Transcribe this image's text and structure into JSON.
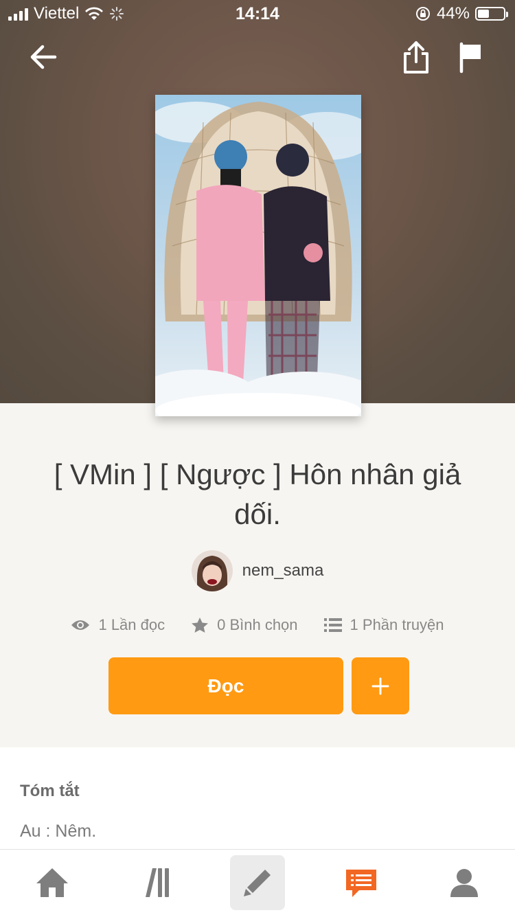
{
  "status_bar": {
    "carrier": "Viettel",
    "time": "14:14",
    "battery_percent": "44%",
    "battery_level": 0.44
  },
  "header": {
    "back_icon": "arrow-left-icon",
    "share_icon": "share-icon",
    "report_icon": "flag-icon"
  },
  "story": {
    "title": "[ VMin ] [ Ngược ] Hôn nhân giả dối.",
    "author": "nem_sama",
    "stats": {
      "reads": "1 Lần đọc",
      "votes": "0 Bình chọn",
      "parts": "1 Phần truyện"
    }
  },
  "actions": {
    "read_label": "Đọc",
    "add_label": "+"
  },
  "summary": {
    "heading": "Tóm tắt",
    "text": "Au : Nêm."
  },
  "tabbar": {
    "items": [
      "home-icon",
      "library-icon",
      "write-icon",
      "messages-icon",
      "profile-icon"
    ]
  },
  "colors": {
    "accent": "#ff9a12",
    "active_tab": "#f26722",
    "hero_bg": "#6a5548"
  }
}
